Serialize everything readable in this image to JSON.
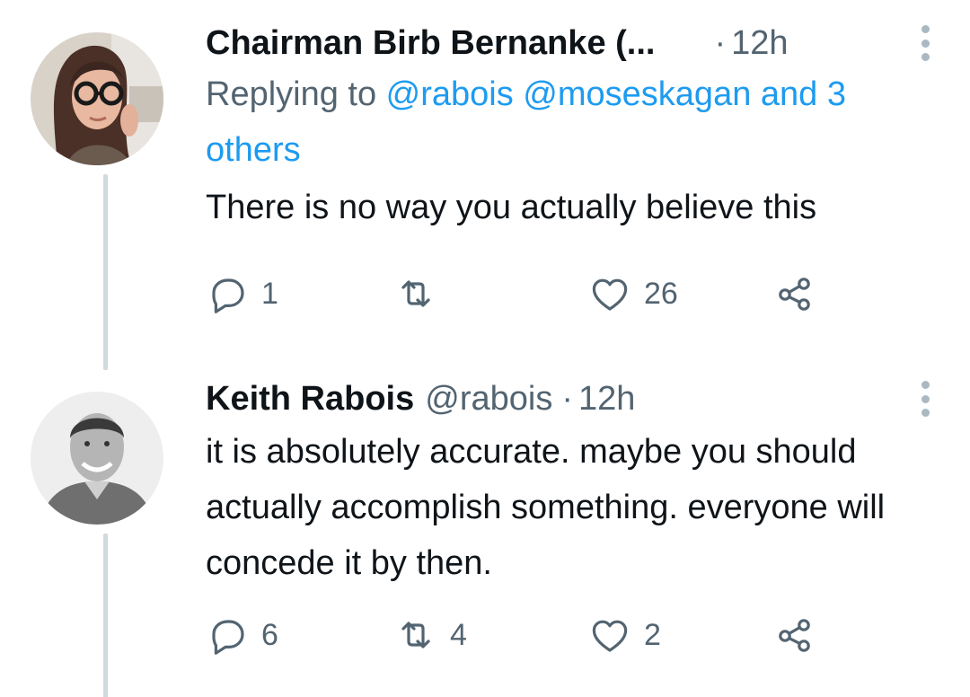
{
  "tweets": [
    {
      "author_name": "Chairman Birb Bernanke (...",
      "author_handle": "",
      "dot": "·",
      "timestamp": "12h",
      "replying_prefix": "Replying to ",
      "replying_mentions": "@rabois @moseskagan and 3 others",
      "text": "There is no way you actually believe this",
      "counts": {
        "replies": "1",
        "retweets": "",
        "likes": "26"
      }
    },
    {
      "author_name": "Keith Rabois",
      "author_handle": "@rabois",
      "dot": "·",
      "timestamp": "12h",
      "text": "it is absolutely accurate.  maybe you should actually accomplish something. everyone will concede it by then.",
      "counts": {
        "replies": "6",
        "retweets": "4",
        "likes": "2"
      }
    }
  ],
  "icons": {
    "reply": "speech-bubble-icon",
    "retweet": "retweet-arrows-icon",
    "like": "heart-icon",
    "share": "share-icon",
    "more": "vertical-ellipsis-icon"
  },
  "colors": {
    "link": "#1d9bf0",
    "muted": "#536471",
    "thread_line": "#cfd9de",
    "text": "#0f1419"
  }
}
